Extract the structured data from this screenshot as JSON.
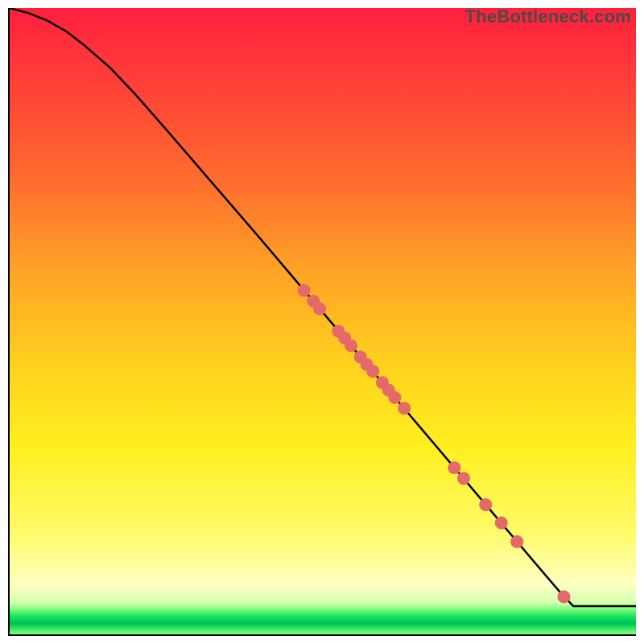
{
  "watermark": "TheBottleneck.com",
  "chart_data": {
    "type": "line",
    "title": "",
    "xlabel": "",
    "ylabel": "",
    "xlim": [
      0,
      100
    ],
    "ylim": [
      0,
      100
    ],
    "grid": false,
    "series": [
      {
        "name": "bottleneck-curve",
        "color": "#000000",
        "x": [
          0,
          3,
          6,
          9,
          12,
          16,
          20,
          25,
          30,
          35,
          40,
          45,
          50,
          55,
          60,
          65,
          70,
          75,
          80,
          85,
          88,
          90,
          100
        ],
        "y": [
          100,
          99.2,
          98.0,
          96.3,
          94.0,
          90.5,
          86.3,
          80.6,
          74.8,
          69.0,
          63.2,
          57.3,
          51.4,
          45.5,
          39.6,
          33.7,
          27.8,
          21.9,
          16.0,
          10.1,
          6.6,
          4.5,
          4.5
        ]
      }
    ],
    "markers": {
      "name": "highlighted-points",
      "color": "#e46a6a",
      "radius_px": 8,
      "points": [
        {
          "x": 47.0,
          "y": 54.9
        },
        {
          "x": 48.5,
          "y": 53.2
        },
        {
          "x": 49.5,
          "y": 52.0
        },
        {
          "x": 52.5,
          "y": 48.4
        },
        {
          "x": 53.5,
          "y": 47.3
        },
        {
          "x": 54.5,
          "y": 46.1
        },
        {
          "x": 56.0,
          "y": 44.3
        },
        {
          "x": 57.0,
          "y": 43.1
        },
        {
          "x": 58.0,
          "y": 42.0
        },
        {
          "x": 59.5,
          "y": 40.2
        },
        {
          "x": 60.5,
          "y": 39.0
        },
        {
          "x": 61.5,
          "y": 37.8
        },
        {
          "x": 63.0,
          "y": 36.1
        },
        {
          "x": 71.0,
          "y": 26.6
        },
        {
          "x": 72.5,
          "y": 24.9
        },
        {
          "x": 76.0,
          "y": 20.7
        },
        {
          "x": 78.5,
          "y": 17.8
        },
        {
          "x": 81.0,
          "y": 14.8
        },
        {
          "x": 88.5,
          "y": 6.0
        }
      ]
    }
  }
}
